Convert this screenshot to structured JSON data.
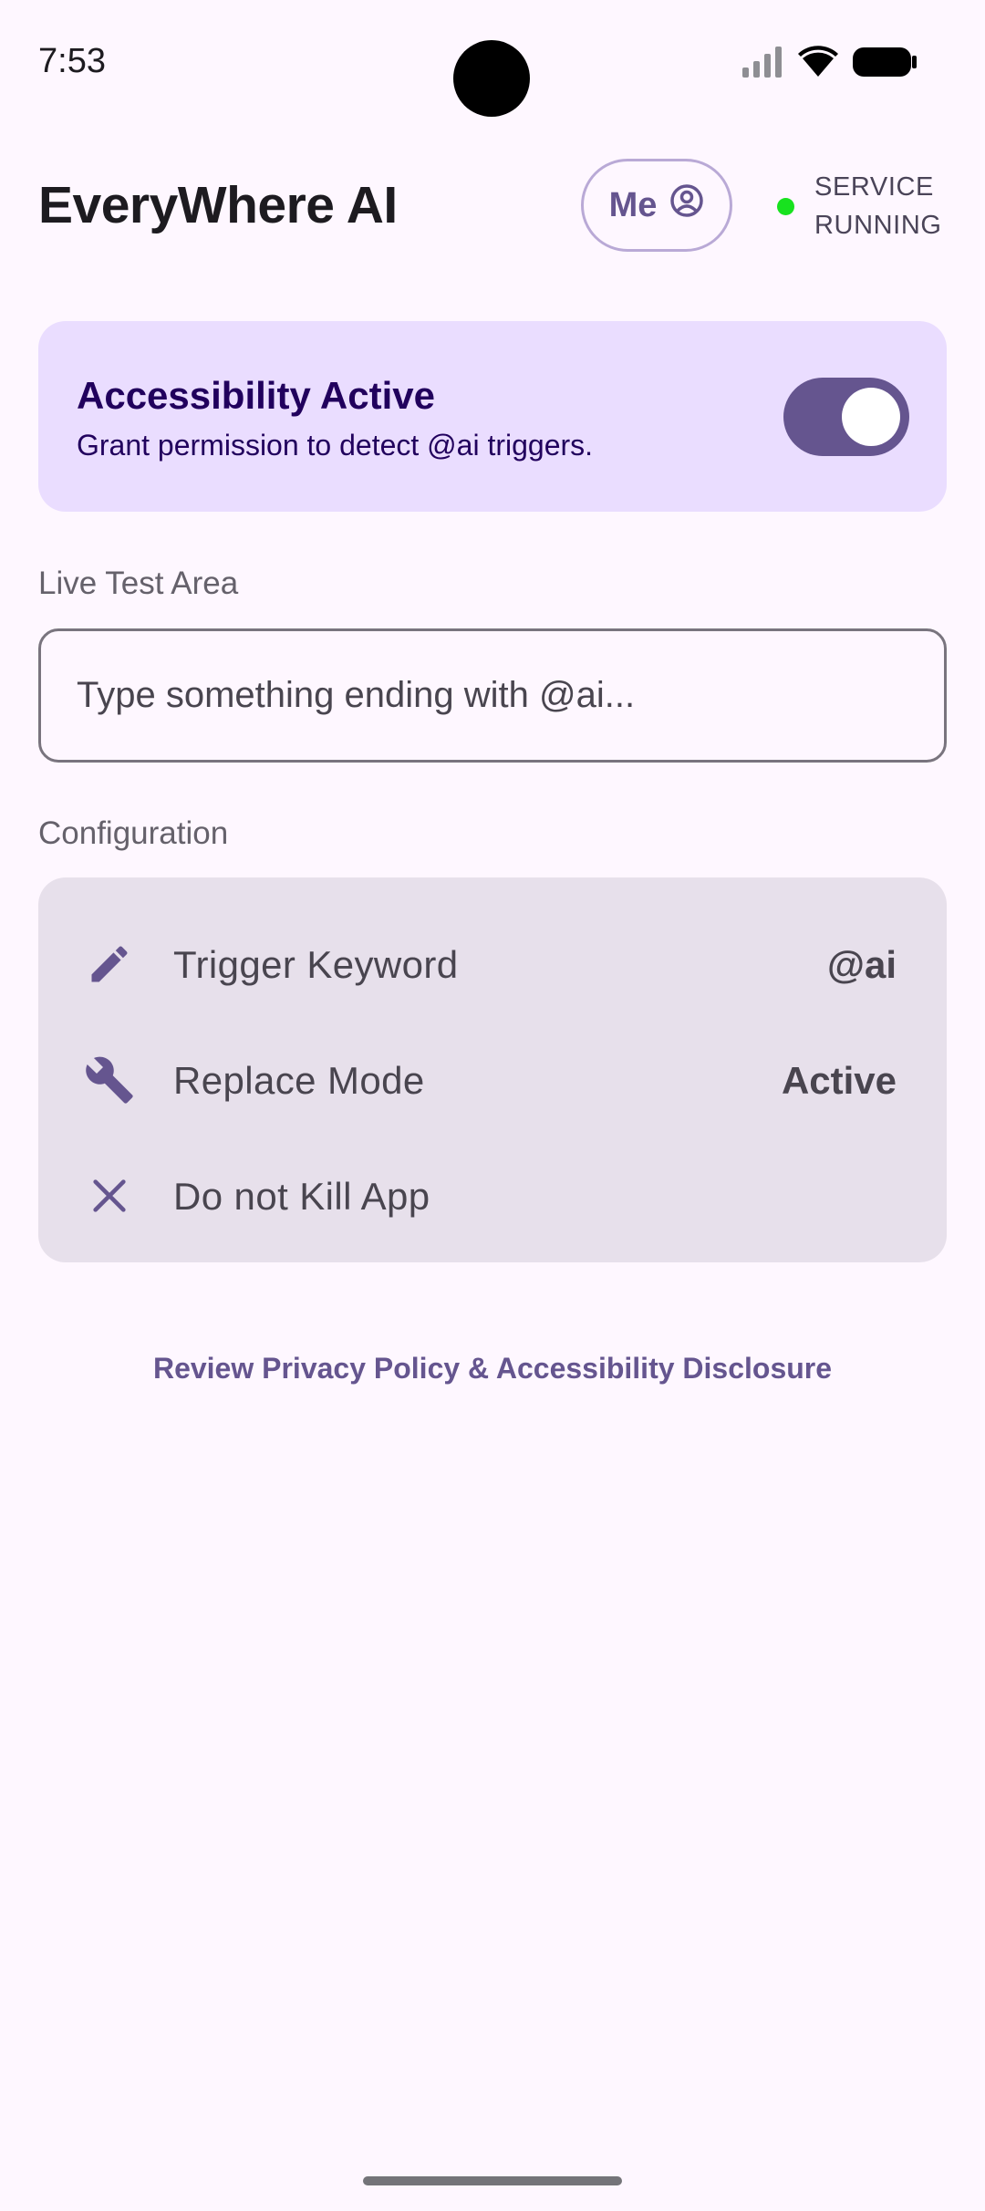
{
  "status_bar": {
    "time": "7:53",
    "icons": [
      "signal-icon",
      "wifi-icon",
      "battery-icon"
    ]
  },
  "header": {
    "title": "EveryWhere AI",
    "me_label": "Me",
    "service_status_line1": "SERVICE",
    "service_status_line2": "RUNNING",
    "service_status_color": "#18E21F"
  },
  "accessibility": {
    "title": "Accessibility Active",
    "subtitle": "Grant permission to detect @ai triggers.",
    "toggle_on": true
  },
  "live_test": {
    "label": "Live Test Area",
    "placeholder": "Type something ending with @ai..."
  },
  "configuration": {
    "label": "Configuration",
    "rows": [
      {
        "icon": "pencil-icon",
        "label": "Trigger Keyword",
        "value": "@ai"
      },
      {
        "icon": "wrench-icon",
        "label": "Replace Mode",
        "value": "Active"
      },
      {
        "icon": "close-icon",
        "label": "Do not Kill App",
        "value": ""
      }
    ]
  },
  "footer": {
    "privacy_link": "Review Privacy Policy & Accessibility Disclosure"
  },
  "colors": {
    "background": "#FEF7FF",
    "accent": "#65558F",
    "card_primary": "#EADDFF",
    "card_surface": "#E7E0EB"
  }
}
